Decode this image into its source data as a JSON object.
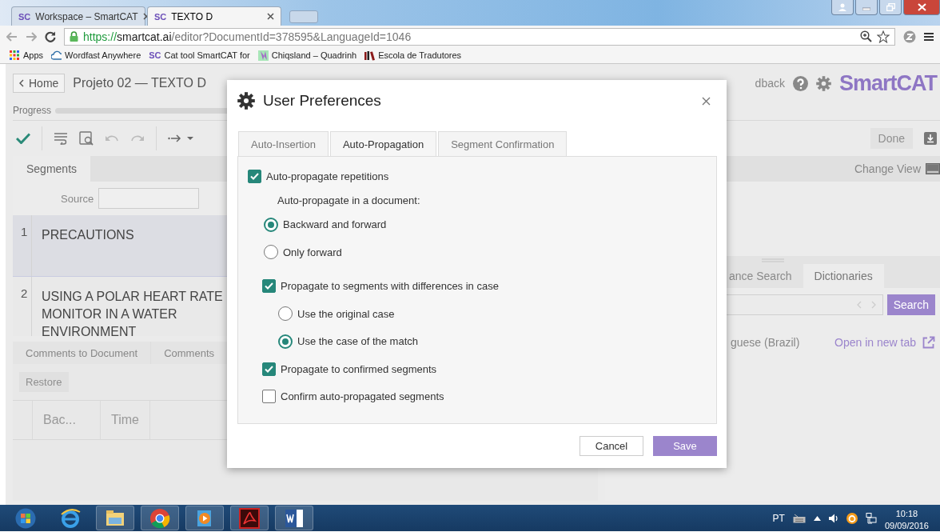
{
  "browser": {
    "tabs": [
      {
        "icon_text": "SC",
        "label": "Workspace – SmartCAT",
        "selected": false
      },
      {
        "icon_text": "SC",
        "label": "TEXTO D",
        "selected": true
      }
    ],
    "url": [
      {
        "kind": "scheme",
        "text": "https://"
      },
      {
        "kind": "host",
        "text": "smartcat.ai"
      },
      {
        "kind": "path",
        "text": "/editor?DocumentId=378595&LanguageId=1046"
      }
    ],
    "bookmarks": [
      {
        "kind": "apps",
        "label": "Apps"
      },
      {
        "kind": "wordfast",
        "label": "Wordfast Anywhere"
      },
      {
        "kind": "sc",
        "icon_text": "SC",
        "label": "Cat tool SmartCAT for"
      },
      {
        "kind": "chiqs",
        "label": "Chiqsland – Quadrinh"
      },
      {
        "kind": "books",
        "label": "Escola de Tradutores"
      }
    ]
  },
  "app": {
    "home": "Home",
    "title": "Projeto 02 — TEXTO D",
    "feedback": "dback",
    "logo": "SmartCAT",
    "progress": {
      "label": "Progress"
    },
    "done": {
      "label": "Done",
      "disabled": true
    },
    "segments": {
      "tab": "Segments",
      "source_label": "Source",
      "rows": [
        {
          "number": "1",
          "text": "PRECAUTIONS",
          "selected": true
        },
        {
          "number": "2",
          "text": "USING A POLAR HEART RATE MONITOR IN A WATER ENVIRONMENT",
          "selected": false
        }
      ]
    },
    "comments": {
      "tabs": [
        "Comments to Document",
        "Comments"
      ],
      "restore": {
        "label": "Restore",
        "disabled": true
      },
      "columns": [
        "Bac...",
        "Time"
      ]
    },
    "right": {
      "change_view": "Change View",
      "tabs": [
        {
          "label": "ance Search",
          "selected": false
        },
        {
          "label": "Dictionaries",
          "selected": true
        }
      ],
      "search_button": "Search",
      "language": "guese (Brazil)",
      "open_link": "Open in new tab"
    }
  },
  "dialog": {
    "title": "User Preferences",
    "tabs": [
      {
        "label": "Auto-Insertion",
        "selected": false
      },
      {
        "label": "Auto-Propagation",
        "selected": true
      },
      {
        "label": "Segment Confirmation",
        "selected": false
      }
    ],
    "options": [
      {
        "kind": "checkbox",
        "label": "Auto-propagate repetitions",
        "checked": true,
        "children": [
          {
            "kind": "caption",
            "label": "Auto-propagate in a document:"
          },
          {
            "kind": "radio",
            "label": "Backward and forward",
            "selected": true
          },
          {
            "kind": "radio",
            "label": "Only forward",
            "selected": false
          },
          {
            "kind": "checkbox",
            "label": "Propagate to segments with differences in case",
            "checked": true,
            "children": [
              {
                "kind": "radio",
                "label": "Use the original case",
                "selected": false
              },
              {
                "kind": "radio",
                "label": "Use the case of the match",
                "selected": true
              }
            ]
          },
          {
            "kind": "checkbox",
            "label": "Propagate to confirmed segments",
            "checked": true
          },
          {
            "kind": "checkbox",
            "label": "Confirm auto-propagated segments",
            "checked": false
          }
        ]
      }
    ],
    "buttons": [
      {
        "label": "Cancel",
        "kind": "secondary"
      },
      {
        "label": "Save",
        "kind": "primary"
      }
    ]
  },
  "taskbar": {
    "language": "PT",
    "time": "10:18",
    "date": "09/09/2016"
  }
}
